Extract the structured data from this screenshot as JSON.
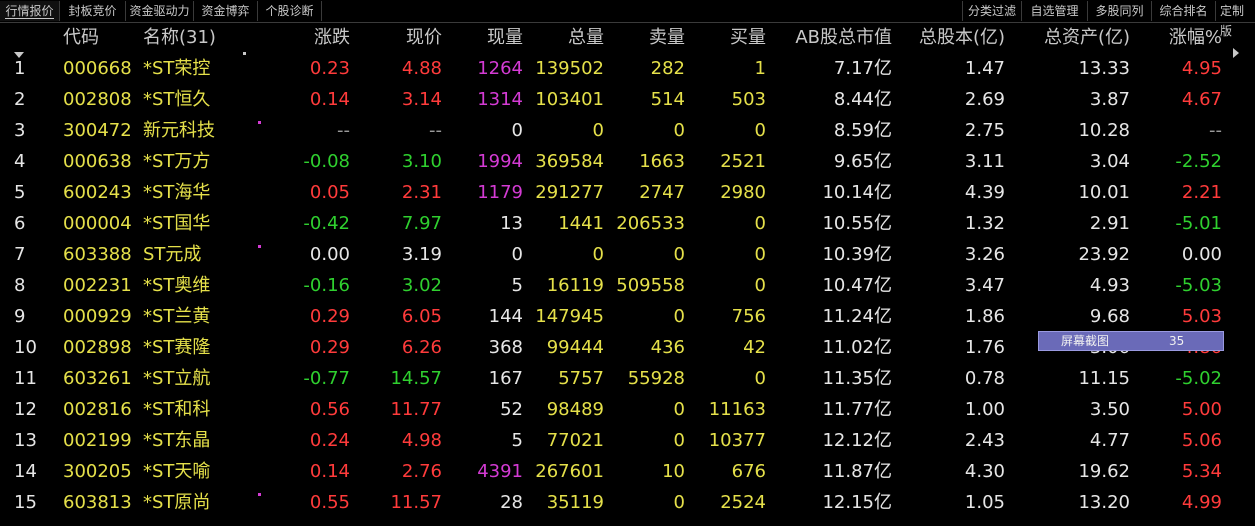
{
  "tabs_left": [
    "行情报价",
    "封板竞价",
    "资金驱动力",
    "资金博弈",
    "个股诊断"
  ],
  "tabs_right": [
    "分类过滤",
    "自选管理",
    "多股同列",
    "综合排名",
    "定制版"
  ],
  "headers": {
    "code": "代码",
    "name": "名称(31)",
    "change": "涨跌",
    "price": "现价",
    "cur_vol": "现量",
    "total_vol": "总量",
    "sell": "卖量",
    "buy": "买量",
    "mktcap": "AB股总市值",
    "shares": "总股本(亿)",
    "assets": "总资产(亿)",
    "pct": "涨幅%"
  },
  "rows": [
    {
      "idx": "1",
      "code": "000668",
      "name": "*ST荣控",
      "change": "0.23",
      "price": "4.88",
      "cur_vol": "1264",
      "total_vol": "139502",
      "sell": "282",
      "buy": "1",
      "mktcap": "7.17亿",
      "shares": "1.47",
      "assets": "13.33",
      "pct": "4.95",
      "dir": "up",
      "vol_color": "magenta",
      "dot": false
    },
    {
      "idx": "2",
      "code": "002808",
      "name": "*ST恒久",
      "change": "0.14",
      "price": "3.14",
      "cur_vol": "1314",
      "total_vol": "103401",
      "sell": "514",
      "buy": "503",
      "mktcap": "8.44亿",
      "shares": "2.69",
      "assets": "3.87",
      "pct": "4.67",
      "dir": "up",
      "vol_color": "magenta",
      "dot": false
    },
    {
      "idx": "3",
      "code": "300472",
      "name": "新元科技",
      "change": "--",
      "price": "--",
      "cur_vol": "0",
      "total_vol": "0",
      "sell": "0",
      "buy": "0",
      "mktcap": "8.59亿",
      "shares": "2.75",
      "assets": "10.28",
      "pct": "--",
      "dir": "none",
      "vol_color": "white",
      "dot": true
    },
    {
      "idx": "4",
      "code": "000638",
      "name": "*ST万方",
      "change": "-0.08",
      "price": "3.10",
      "cur_vol": "1994",
      "total_vol": "369584",
      "sell": "1663",
      "buy": "2521",
      "mktcap": "9.65亿",
      "shares": "3.11",
      "assets": "3.04",
      "pct": "-2.52",
      "dir": "down",
      "vol_color": "magenta",
      "dot": false
    },
    {
      "idx": "5",
      "code": "600243",
      "name": "*ST海华",
      "change": "0.05",
      "price": "2.31",
      "cur_vol": "1179",
      "total_vol": "291277",
      "sell": "2747",
      "buy": "2980",
      "mktcap": "10.14亿",
      "shares": "4.39",
      "assets": "10.01",
      "pct": "2.21",
      "dir": "up",
      "vol_color": "magenta",
      "dot": false
    },
    {
      "idx": "6",
      "code": "000004",
      "name": "*ST国华",
      "change": "-0.42",
      "price": "7.97",
      "cur_vol": "13",
      "total_vol": "1441",
      "sell": "206533",
      "buy": "0",
      "mktcap": "10.55亿",
      "shares": "1.32",
      "assets": "2.91",
      "pct": "-5.01",
      "dir": "down",
      "vol_color": "white",
      "dot": false
    },
    {
      "idx": "7",
      "code": "603388",
      "name": "ST元成",
      "change": "0.00",
      "price": "3.19",
      "cur_vol": "0",
      "total_vol": "0",
      "sell": "0",
      "buy": "0",
      "mktcap": "10.39亿",
      "shares": "3.26",
      "assets": "23.92",
      "pct": "0.00",
      "dir": "flat",
      "vol_color": "white",
      "dot": true
    },
    {
      "idx": "8",
      "code": "002231",
      "name": "*ST奥维",
      "change": "-0.16",
      "price": "3.02",
      "cur_vol": "5",
      "total_vol": "16119",
      "sell": "509558",
      "buy": "0",
      "mktcap": "10.47亿",
      "shares": "3.47",
      "assets": "4.93",
      "pct": "-5.03",
      "dir": "down",
      "vol_color": "white",
      "dot": false
    },
    {
      "idx": "9",
      "code": "000929",
      "name": "*ST兰黄",
      "change": "0.29",
      "price": "6.05",
      "cur_vol": "144",
      "total_vol": "147945",
      "sell": "0",
      "buy": "756",
      "mktcap": "11.24亿",
      "shares": "1.86",
      "assets": "9.68",
      "pct": "5.03",
      "dir": "up",
      "vol_color": "white",
      "dot": false
    },
    {
      "idx": "10",
      "code": "002898",
      "name": "*ST赛隆",
      "change": "0.29",
      "price": "6.26",
      "cur_vol": "368",
      "total_vol": "99444",
      "sell": "436",
      "buy": "42",
      "mktcap": "11.02亿",
      "shares": "1.76",
      "assets": "3.06",
      "pct": "4.86",
      "dir": "up",
      "vol_color": "white",
      "dot": false
    },
    {
      "idx": "11",
      "code": "603261",
      "name": "*ST立航",
      "change": "-0.77",
      "price": "14.57",
      "cur_vol": "167",
      "total_vol": "5757",
      "sell": "55928",
      "buy": "0",
      "mktcap": "11.35亿",
      "shares": "0.78",
      "assets": "11.15",
      "pct": "-5.02",
      "dir": "down",
      "vol_color": "white",
      "dot": false
    },
    {
      "idx": "12",
      "code": "002816",
      "name": "*ST和科",
      "change": "0.56",
      "price": "11.77",
      "cur_vol": "52",
      "total_vol": "98489",
      "sell": "0",
      "buy": "11163",
      "mktcap": "11.77亿",
      "shares": "1.00",
      "assets": "3.50",
      "pct": "5.00",
      "dir": "up",
      "vol_color": "white",
      "dot": false
    },
    {
      "idx": "13",
      "code": "002199",
      "name": "*ST东晶",
      "change": "0.24",
      "price": "4.98",
      "cur_vol": "5",
      "total_vol": "77021",
      "sell": "0",
      "buy": "10377",
      "mktcap": "12.12亿",
      "shares": "2.43",
      "assets": "4.77",
      "pct": "5.06",
      "dir": "up",
      "vol_color": "white",
      "dot": false
    },
    {
      "idx": "14",
      "code": "300205",
      "name": "*ST天喻",
      "change": "0.14",
      "price": "2.76",
      "cur_vol": "4391",
      "total_vol": "267601",
      "sell": "10",
      "buy": "676",
      "mktcap": "11.87亿",
      "shares": "4.30",
      "assets": "19.62",
      "pct": "5.34",
      "dir": "up",
      "vol_color": "magenta",
      "dot": false
    },
    {
      "idx": "15",
      "code": "603813",
      "name": "*ST原尚",
      "change": "0.55",
      "price": "11.57",
      "cur_vol": "28",
      "total_vol": "35119",
      "sell": "0",
      "buy": "2524",
      "mktcap": "12.15亿",
      "shares": "1.05",
      "assets": "13.20",
      "pct": "4.99",
      "dir": "up",
      "vol_color": "white",
      "dot": true
    }
  ],
  "overlay": {
    "label": "屏幕截图",
    "value": "35"
  }
}
